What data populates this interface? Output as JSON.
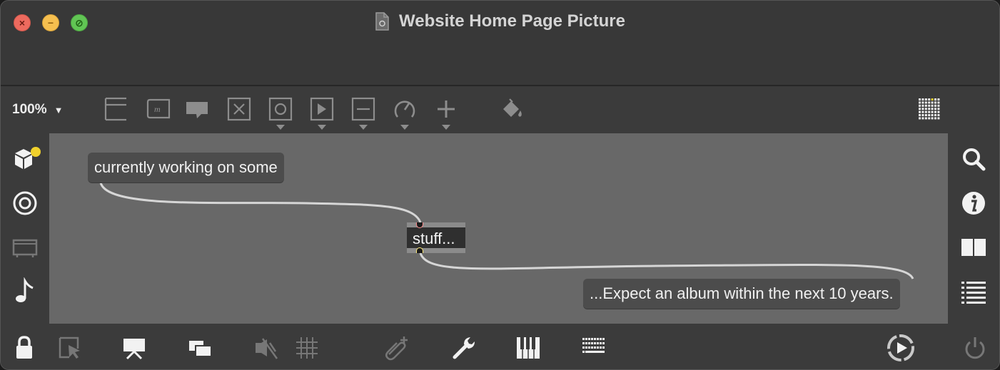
{
  "window": {
    "title": "Website Home Page Picture",
    "controls": {
      "close_glyph": "×",
      "minimize_glyph": "−",
      "zoom_glyph": "⊘"
    }
  },
  "toolbar": {
    "zoom_level": "100%",
    "zoom_caret": "▼",
    "icons": [
      "lines-object-icon",
      "message-object-icon",
      "comment-icon",
      "toggle-object-icon",
      "button-object-icon",
      "play-object-icon",
      "slider-object-icon",
      "dial-object-icon",
      "add-object-icon",
      "paint-bucket-icon",
      "grid-palette-icon"
    ]
  },
  "left_sidebar": {
    "icons": [
      "packages-icon",
      "target-icon",
      "presentation-frame-icon",
      "music-note-icon"
    ],
    "badge_color": "#f0d12c"
  },
  "right_sidebar": {
    "icons": [
      "search-icon",
      "info-icon",
      "columns-icon",
      "list-icon"
    ]
  },
  "canvas": {
    "background": "#686868",
    "messages": [
      {
        "text": "currently working on some"
      },
      {
        "text": "...Expect an album within the next 10 years."
      }
    ],
    "object": {
      "text": "stuff..."
    }
  },
  "bottom_bar": {
    "icons": [
      "lock-icon",
      "edit-cursor-icon",
      "presentation-icon",
      "windows-icon",
      "mute-icon",
      "grid-icon",
      "attach-icon",
      "wrench-icon",
      "piano-keyboard-icon",
      "keyboard-icon",
      "play-circle-icon",
      "power-icon"
    ]
  },
  "colors": {
    "window_bg": "#3b3b3b",
    "canvas_bg": "#686868",
    "message_bg": "#4c4c4c",
    "object_bg": "#2f2f2f",
    "cable": "#d6d6d6"
  }
}
